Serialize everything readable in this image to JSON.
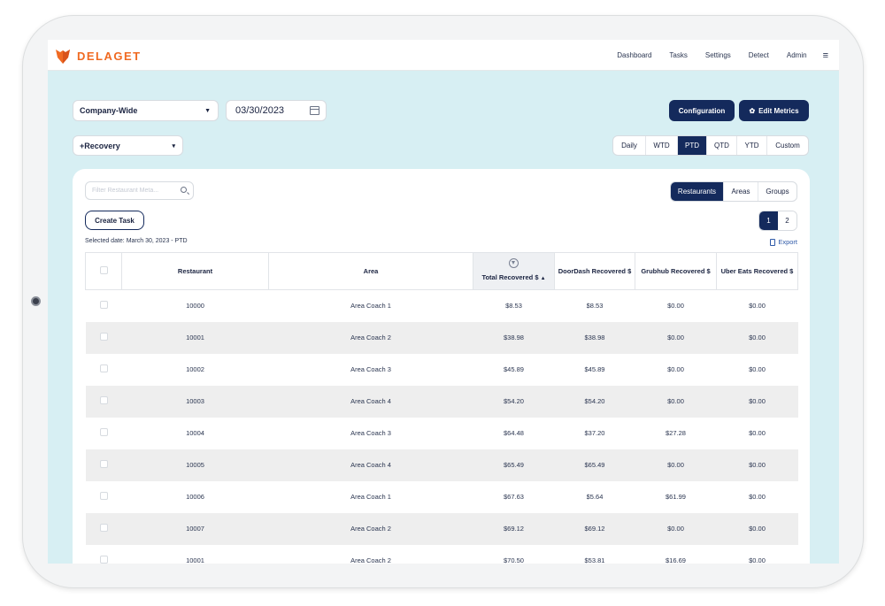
{
  "brand": {
    "name": "DELAGET",
    "color": "#f06a22"
  },
  "nav": [
    "Dashboard",
    "Tasks",
    "Settings",
    "Detect",
    "Admin"
  ],
  "filters": {
    "scope": "Company-Wide",
    "date": "03/30/2023",
    "metric": "+Recovery"
  },
  "buttons": {
    "configuration": "Configuration",
    "edit_metrics": "Edit Metrics",
    "create_task": "Create Task"
  },
  "periods": [
    {
      "label": "Daily",
      "active": false
    },
    {
      "label": "WTD",
      "active": false
    },
    {
      "label": "PTD",
      "active": true
    },
    {
      "label": "QTD",
      "active": false
    },
    {
      "label": "YTD",
      "active": false
    },
    {
      "label": "Custom",
      "active": false
    }
  ],
  "views": [
    {
      "label": "Restaurants",
      "active": true
    },
    {
      "label": "Areas",
      "active": false
    },
    {
      "label": "Groups",
      "active": false
    }
  ],
  "search": {
    "placeholder": "Filter Restaurant Meta..."
  },
  "selected_date": "Selected date: March 30, 2023 - PTD",
  "pages": [
    {
      "label": "1",
      "active": true
    },
    {
      "label": "2",
      "active": false
    }
  ],
  "export": "Export",
  "table": {
    "columns": [
      "Restaurant",
      "Area",
      "Total Recovered $",
      "DoorDash Recovered $",
      "Grubhub Recovered $",
      "Uber Eats Recovered $"
    ],
    "rows": [
      [
        "10000",
        "Area Coach 1",
        "$8.53",
        "$8.53",
        "$0.00",
        "$0.00"
      ],
      [
        "10001",
        "Area Coach 2",
        "$38.98",
        "$38.98",
        "$0.00",
        "$0.00"
      ],
      [
        "10002",
        "Area Coach 3",
        "$45.89",
        "$45.89",
        "$0.00",
        "$0.00"
      ],
      [
        "10003",
        "Area Coach 4",
        "$54.20",
        "$54.20",
        "$0.00",
        "$0.00"
      ],
      [
        "10004",
        "Area Coach 3",
        "$64.48",
        "$37.20",
        "$27.28",
        "$0.00"
      ],
      [
        "10005",
        "Area Coach 4",
        "$65.49",
        "$65.49",
        "$0.00",
        "$0.00"
      ],
      [
        "10006",
        "Area Coach 1",
        "$67.63",
        "$5.64",
        "$61.99",
        "$0.00"
      ],
      [
        "10007",
        "Area Coach 2",
        "$69.12",
        "$69.12",
        "$0.00",
        "$0.00"
      ],
      [
        "10001",
        "Area Coach 2",
        "$70.50",
        "$53.81",
        "$16.69",
        "$0.00"
      ]
    ]
  }
}
